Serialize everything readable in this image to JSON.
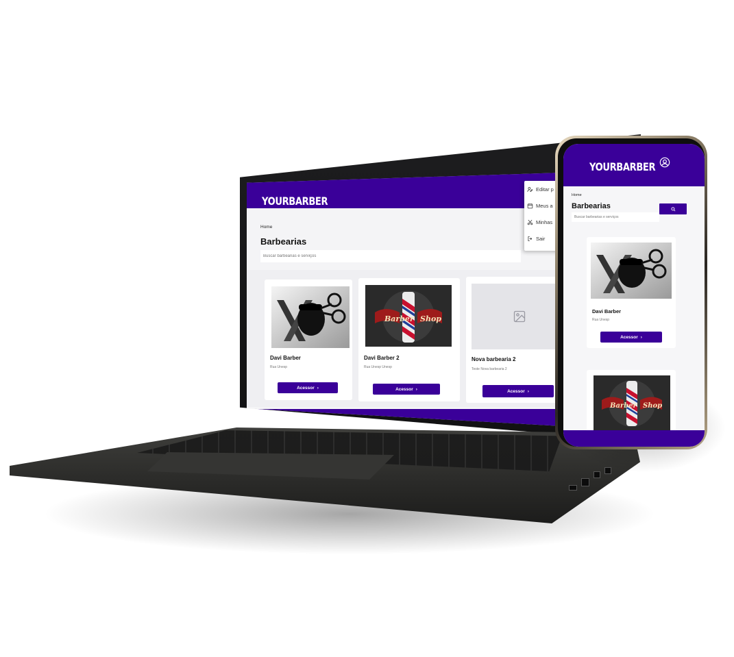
{
  "brand_color": "#3a0099",
  "laptop": {
    "logo": "YOURBARBER",
    "breadcrumb": "Home",
    "page_title": "Barbearias",
    "search_placeholder": "Buscar barbearias e serviços",
    "menu": [
      {
        "label": "Editar p",
        "icon": "edit-profile-icon"
      },
      {
        "label": "Meus a",
        "icon": "calendar-icon"
      },
      {
        "label": "Minhas",
        "icon": "scissors-icon"
      },
      {
        "label": "Sair",
        "icon": "logout-icon"
      }
    ],
    "cards": [
      {
        "name": "Davi Barber",
        "address": "Rua Unesp",
        "button": "Acessor",
        "image": "beard-logo-image"
      },
      {
        "name": "Davi Barber 2",
        "address": "Rua Unesp Unesp",
        "button": "Acessor",
        "image": "barber-shop-logo-image"
      },
      {
        "name": "Nova barbearia 2",
        "address": "Teste Nova barbearia 2",
        "button": "Acessor",
        "image": "placeholder-image-icon"
      }
    ]
  },
  "phone": {
    "logo": "YOURBARBER",
    "breadcrumb": "Home",
    "page_title": "Barbearias",
    "search_placeholder": "Buscar barbearias e serviços",
    "cards": [
      {
        "name": "Davi Barber",
        "address": "Rua Unesp",
        "button": "Acessor",
        "image": "beard-logo-image"
      },
      {
        "name": "",
        "address": "",
        "button": "",
        "image": "barber-shop-logo-image"
      }
    ]
  }
}
